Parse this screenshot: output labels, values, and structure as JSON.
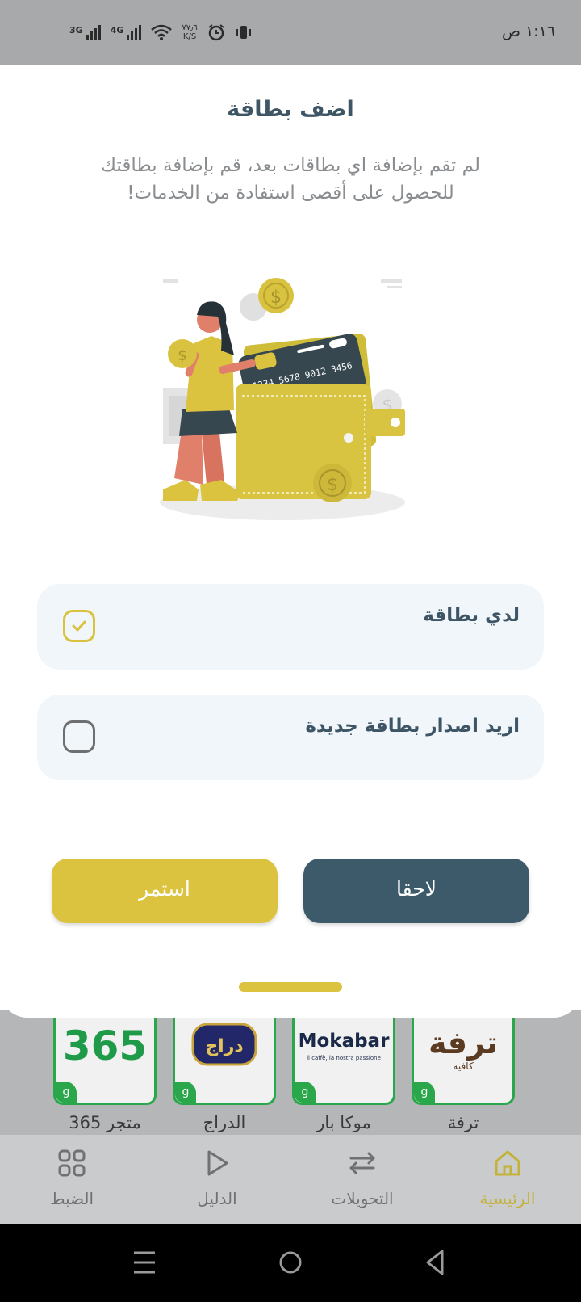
{
  "status_bar": {
    "time": "١:١٦ ص",
    "net1": "3G",
    "net2": "4G",
    "speed_value": "٧٧٫٦",
    "speed_unit": "K/S",
    "icons": [
      "signal-icon",
      "signal-icon",
      "wifi-icon",
      "alarm-icon",
      "vibrate-icon"
    ]
  },
  "sheet": {
    "title": "اضف بطاقة",
    "subtitle": "لم تقم بإضافة اي بطاقات بعد، قم بإضافة بطاقتك للحصول على أقصى استفادة من الخدمات!",
    "card_number": "1234  5678  9012  3456",
    "options": [
      {
        "label": "لدي بطاقة",
        "checked": true
      },
      {
        "label": "اريد اصدار بطاقة جديدة",
        "checked": false
      }
    ],
    "continue_label": "استمر",
    "later_label": "لاحقا"
  },
  "stores": [
    {
      "name": "ترفة",
      "logo": "ترفة",
      "logo_sub": "كافيه"
    },
    {
      "name": "موكا بار",
      "logo": "Mokabar",
      "logo_sub": "il caffè, la nostra passione"
    },
    {
      "name": "الدراج",
      "logo": "دراج",
      "logo_sub": ""
    },
    {
      "name": "متجر 365",
      "logo": "365",
      "logo_sub": ""
    }
  ],
  "bottom_nav": [
    {
      "label": "الرئيسية",
      "icon": "home-icon",
      "active": true
    },
    {
      "label": "التحويلات",
      "icon": "transfer-icon",
      "active": false
    },
    {
      "label": "الدليل",
      "icon": "play-icon",
      "active": false
    },
    {
      "label": "الضبط",
      "icon": "grid-icon",
      "active": false
    }
  ],
  "colors": {
    "accent_yellow": "#dbc33f",
    "primary_dark": "#3d5a6b",
    "store_green": "#2aa74a"
  }
}
